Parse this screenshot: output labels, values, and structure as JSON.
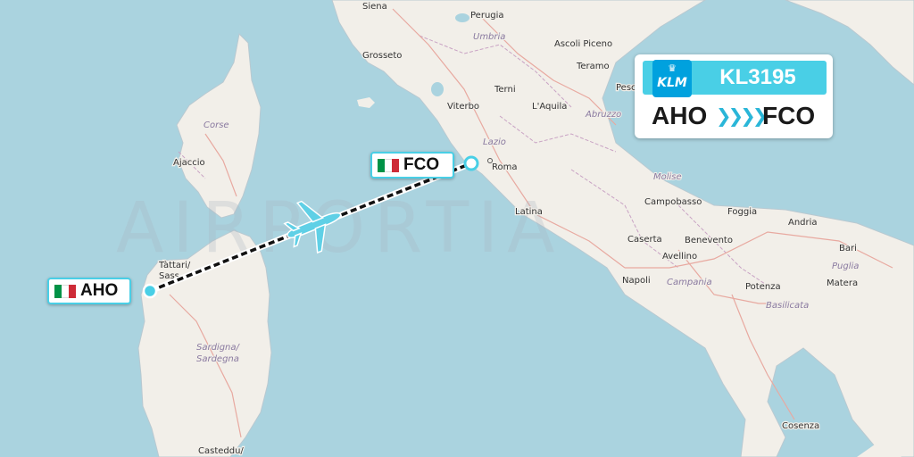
{
  "flight": {
    "number": "KL3195",
    "airline_logo_text": "KLM",
    "origin": "AHO",
    "destination": "FCO",
    "route_arrows": "❯❯❯❯",
    "accent_color": "#49cfe6",
    "airline_color": "#00a1de",
    "path_color": "#111111"
  },
  "origin_tag": {
    "code": "AHO",
    "flag": "italy-flag",
    "flag_colors": [
      "#009246",
      "#ffffff",
      "#ce2b37"
    ]
  },
  "destination_tag": {
    "code": "FCO",
    "flag": "italy-flag",
    "flag_colors": [
      "#009246",
      "#ffffff",
      "#ce2b37"
    ]
  },
  "watermark": "AIRPORTIA",
  "map_labels": {
    "siena": "Siena",
    "perugia": "Perugia",
    "umbria": "Umbria",
    "ascoli": "Ascoli Piceno",
    "grosseto": "Grosseto",
    "teramo": "Teramo",
    "pescara": "Pesc",
    "terni": "Terni",
    "viterbo": "Viterbo",
    "laquila": "L'Aquila",
    "abruzzo": "Abruzzo",
    "corse": "Corse",
    "ajaccio": "Ajaccio",
    "lazio": "Lazio",
    "roma": "Roma",
    "molise": "Molise",
    "campobasso": "Campobasso",
    "foggia": "Foggia",
    "latina": "Latina",
    "andria": "Andria",
    "bari": "Bari",
    "caserta": "Caserta",
    "benevento": "Benevento",
    "puglia": "Puglia",
    "avellino": "Avellino",
    "sassari": "Tàttari/\nSass",
    "napoli": "Napoli",
    "campania": "Campania",
    "potenza": "Potenza",
    "matera": "Matera",
    "basilicata": "Basilicata",
    "sardegna": "Sardigna/\nSardegna",
    "cosenza": "Cosenza",
    "cagliari": "Casteddu/"
  }
}
